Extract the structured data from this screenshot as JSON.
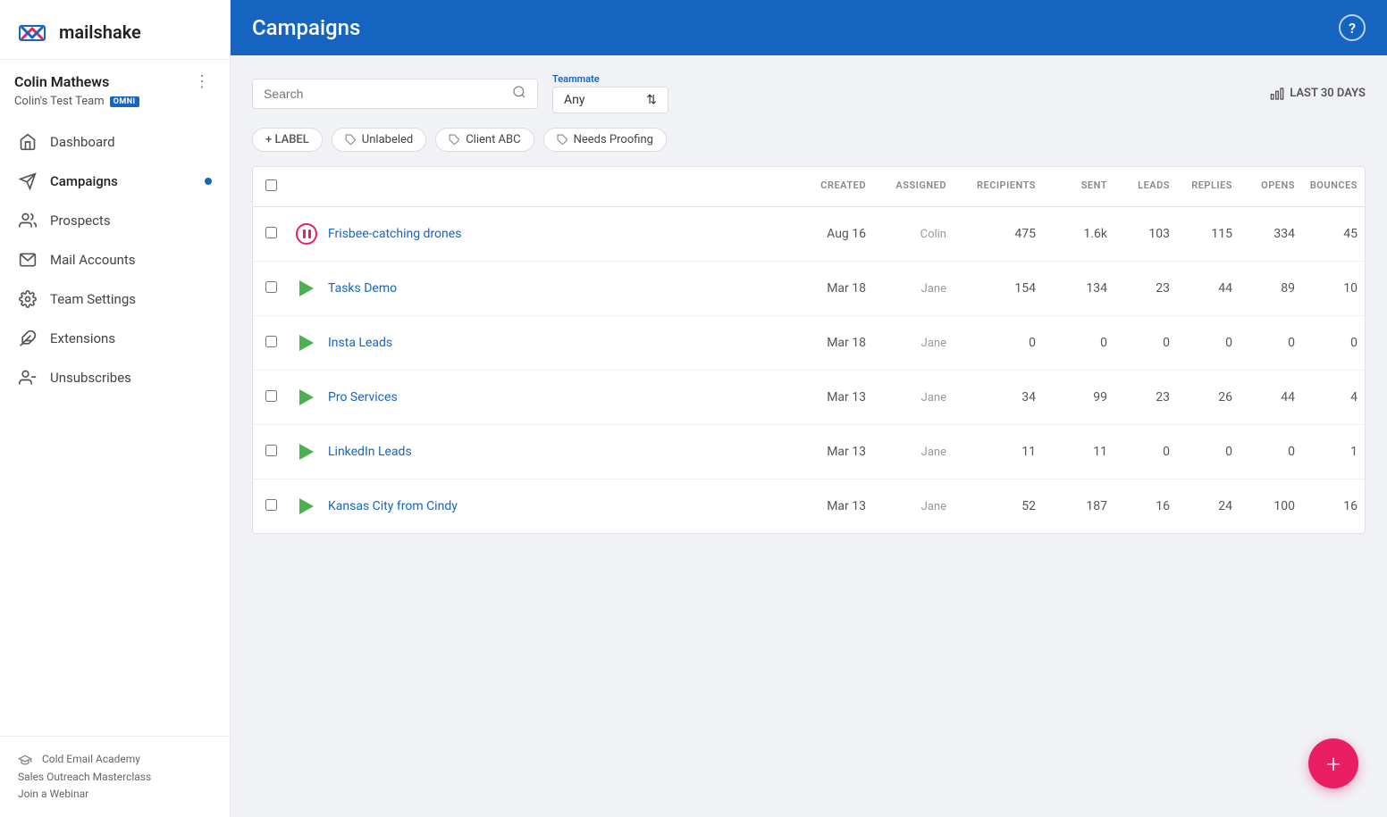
{
  "sidebar": {
    "logo_text": "mailshake",
    "user_name": "Colin Mathews",
    "team_name": "Colin's Test Team",
    "omni_badge": "OMNI",
    "nav_items": [
      {
        "id": "dashboard",
        "label": "Dashboard",
        "icon": "home"
      },
      {
        "id": "campaigns",
        "label": "Campaigns",
        "icon": "campaigns",
        "active": true,
        "dot": true
      },
      {
        "id": "prospects",
        "label": "Prospects",
        "icon": "prospects"
      },
      {
        "id": "mail-accounts",
        "label": "Mail Accounts",
        "icon": "mail"
      },
      {
        "id": "team-settings",
        "label": "Team Settings",
        "icon": "settings"
      },
      {
        "id": "extensions",
        "label": "Extensions",
        "icon": "extensions"
      },
      {
        "id": "unsubscribes",
        "label": "Unsubscribes",
        "icon": "unsubscribes"
      }
    ],
    "footer_links": [
      "Cold Email Academy",
      "Sales Outreach Masterclass",
      "Join a Webinar"
    ]
  },
  "topbar": {
    "title": "Campaigns",
    "help_label": "?"
  },
  "toolbar": {
    "search_placeholder": "Search",
    "teammate_label": "Teammate",
    "teammate_value": "Any",
    "date_filter": "LAST 30 DAYS"
  },
  "labels": [
    {
      "id": "add-label",
      "text": "+ LABEL",
      "type": "add"
    },
    {
      "id": "unlabeled",
      "text": "Unlabeled"
    },
    {
      "id": "client-abc",
      "text": "Client ABC"
    },
    {
      "id": "needs-proofing",
      "text": "Needs Proofing"
    }
  ],
  "table": {
    "columns": [
      "",
      "",
      "CREATED",
      "ASSIGNED",
      "RECIPIENTS",
      "SENT",
      "LEADS",
      "REPLIES",
      "OPENS",
      "BOUNCES"
    ],
    "rows": [
      {
        "id": "frisbee",
        "status": "pause",
        "name": "Frisbee-catching drones",
        "created": "Aug 16",
        "assigned": "Colin",
        "recipients": "475",
        "sent": "1.6k",
        "leads": "103",
        "replies": "115",
        "opens": "334",
        "bounces": "45"
      },
      {
        "id": "tasks-demo",
        "status": "play",
        "name": "Tasks Demo",
        "created": "Mar 18",
        "assigned": "Jane",
        "recipients": "154",
        "sent": "134",
        "leads": "23",
        "replies": "44",
        "opens": "89",
        "bounces": "10"
      },
      {
        "id": "insta-leads",
        "status": "play",
        "name": "Insta Leads",
        "created": "Mar 18",
        "assigned": "Jane",
        "recipients": "0",
        "sent": "0",
        "leads": "0",
        "replies": "0",
        "opens": "0",
        "bounces": "0"
      },
      {
        "id": "pro-services",
        "status": "play",
        "name": "Pro Services",
        "created": "Mar 13",
        "assigned": "Jane",
        "recipients": "34",
        "sent": "99",
        "leads": "23",
        "replies": "26",
        "opens": "44",
        "bounces": "4"
      },
      {
        "id": "linkedin-leads",
        "status": "play",
        "name": "LinkedIn Leads",
        "created": "Mar 13",
        "assigned": "Jane",
        "recipients": "11",
        "sent": "11",
        "leads": "0",
        "replies": "0",
        "opens": "0",
        "bounces": "1"
      },
      {
        "id": "kansas-city",
        "status": "play",
        "name": "Kansas City from Cindy",
        "created": "Mar 13",
        "assigned": "Jane",
        "recipients": "52",
        "sent": "187",
        "leads": "16",
        "replies": "24",
        "opens": "100",
        "bounces": "16"
      }
    ]
  },
  "fab": {
    "label": "+"
  }
}
